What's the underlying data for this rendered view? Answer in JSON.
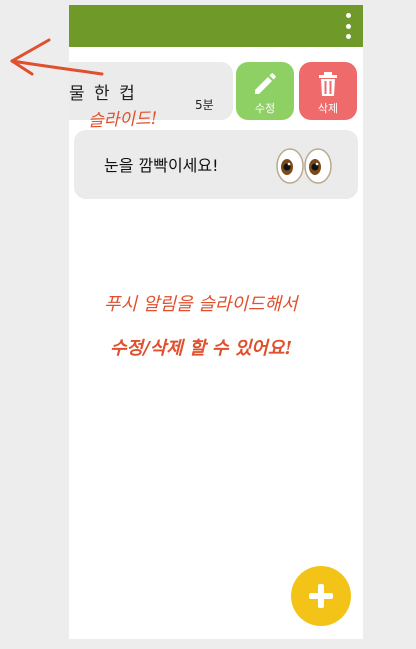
{
  "card1": {
    "title": "물 한 컵",
    "time": "5분"
  },
  "actions": {
    "edit_label": "수정",
    "delete_label": "삭제"
  },
  "card2": {
    "text": "눈을 깜빡이세요!"
  },
  "annotations": {
    "slide": "슬라이드!",
    "line1": "푸시 알림을 슬라이드해서",
    "line2": "수정/삭제 할 수 있어요!"
  },
  "colors": {
    "appbar": "#6f9a2a",
    "edit": "#8fd065",
    "delete": "#ef6a6a",
    "fab": "#f3c317",
    "annotation": "#e0502e"
  },
  "icons": {
    "menu": "more-vert-icon",
    "edit": "pencil-icon",
    "delete": "trash-icon",
    "eyes": "eyes-emoji-icon",
    "fab": "plus-icon"
  }
}
